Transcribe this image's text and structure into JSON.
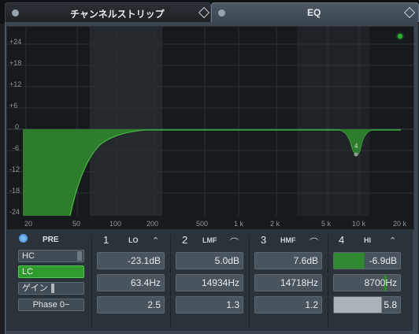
{
  "tabs": {
    "channel_strip": "チャンネルストリップ",
    "eq": "EQ"
  },
  "graph": {
    "y_ticks": [
      "+24",
      "+18",
      "+12",
      "+6",
      "0",
      "-6",
      "-12",
      "-18",
      "-24"
    ],
    "x_ticks": [
      "20",
      "50",
      "100",
      "200",
      "500",
      "1 k",
      "2 k",
      "5 k",
      "10 k",
      "20 k"
    ],
    "node_label": "4",
    "colors": {
      "curve": "#3fae3f",
      "fill": "#2c7a2a",
      "led": "#2fb32f"
    }
  },
  "pre": {
    "label": "PRE",
    "hc": "HC",
    "lc": "LC",
    "gain": "ゲイン",
    "phase": "Phase 0−"
  },
  "bands": [
    {
      "num": "1",
      "type": "LO",
      "gain": "-23.1dB",
      "freq": "63.4Hz",
      "q": "2.5"
    },
    {
      "num": "2",
      "type": "LMF",
      "gain": "5.0dB",
      "freq": "14934Hz",
      "q": "1.3"
    },
    {
      "num": "3",
      "type": "HMF",
      "gain": "7.6dB",
      "freq": "14718Hz",
      "q": "1.2"
    },
    {
      "num": "4",
      "type": "HI",
      "gain": "-6.9dB",
      "freq": "8700Hz",
      "q": "5.8"
    }
  ]
}
